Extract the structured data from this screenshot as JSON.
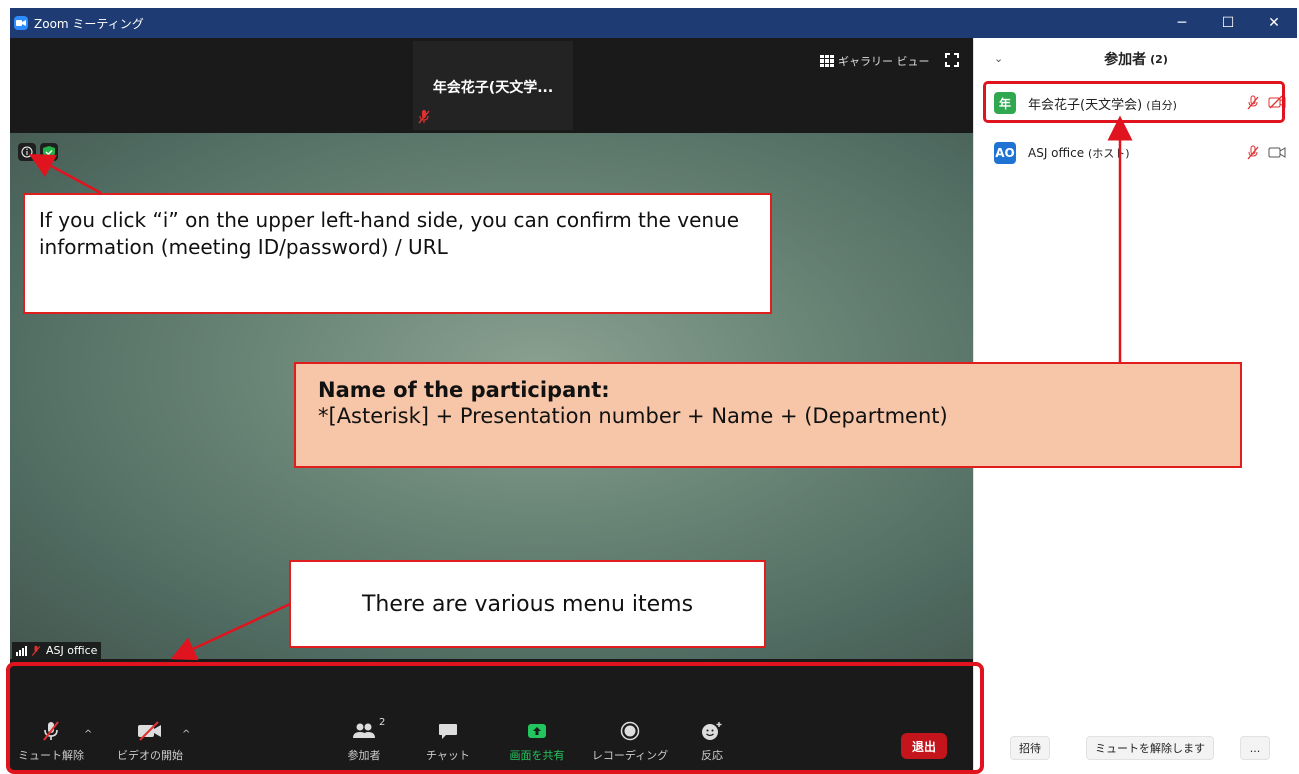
{
  "window": {
    "title": "Zoom ミーティング",
    "controls": [
      "─",
      "☐",
      "✕"
    ]
  },
  "top_strip": {
    "thumbnail_name": "年会花子(天文学...",
    "gallery_view_label": "ギャラリー ビュー"
  },
  "video": {
    "speaker_label": "ASJ office"
  },
  "toolbar": {
    "items": [
      {
        "label": "ミュート解除",
        "icon": "mic-off-icon"
      },
      {
        "label": "ビデオの開始",
        "icon": "video-off-icon"
      },
      {
        "label": "参加者",
        "icon": "participants-icon",
        "badge": "2"
      },
      {
        "label": "チャット",
        "icon": "chat-icon"
      },
      {
        "label": "画面を共有",
        "icon": "share-screen-icon"
      },
      {
        "label": "レコーディング",
        "icon": "record-icon"
      },
      {
        "label": "反応",
        "icon": "reaction-icon"
      }
    ],
    "leave_label": "退出"
  },
  "panel": {
    "title": "参加者",
    "count": "(2)",
    "participants": [
      {
        "avatar": "年",
        "avatar_color": "#2fa84f",
        "name": "年会花子(天文学会)",
        "suffix": "(自分)"
      },
      {
        "avatar": "AO",
        "avatar_color": "#1f73d3",
        "name": "ASJ office",
        "suffix": "(ホスト)"
      }
    ],
    "footer": {
      "invite": "招待",
      "unmute_all": "ミュートを解除します",
      "more": "..."
    }
  },
  "annotations": {
    "info_note": "If you click “i” on the upper left-hand side, you can confirm the venue information (meeting ID/password) / URL",
    "participant_heading": "Name of the participant:",
    "participant_format": "*[Asterisk] + Presentation number + Name + (Department)",
    "menu_note": "There are various menu items"
  },
  "colors": {
    "titlebar": "#1e3c73",
    "annotation_red": "#e0141e",
    "callout_fill": "#f7c6a8",
    "leave_red": "#c4151c",
    "share_green": "#22c55e"
  }
}
